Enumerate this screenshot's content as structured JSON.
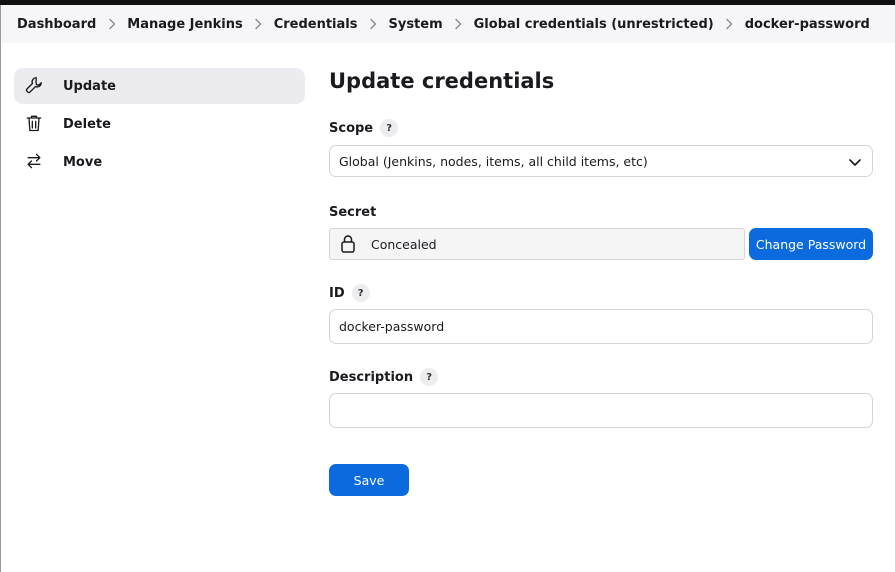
{
  "breadcrumb": [
    "Dashboard",
    "Manage Jenkins",
    "Credentials",
    "System",
    "Global credentials (unrestricted)",
    "docker-password"
  ],
  "sidebar": {
    "items": [
      {
        "label": "Update",
        "icon": "wrench-icon",
        "active": true
      },
      {
        "label": "Delete",
        "icon": "trash-icon",
        "active": false
      },
      {
        "label": "Move",
        "icon": "arrows-swap-icon",
        "active": false
      }
    ]
  },
  "main": {
    "title": "Update credentials",
    "scope": {
      "label": "Scope",
      "help": "?",
      "value": "Global (Jenkins, nodes, items, all child items, etc)"
    },
    "secret": {
      "label": "Secret",
      "value": "Concealed",
      "button": "Change Password"
    },
    "id": {
      "label": "ID",
      "help": "?",
      "value": "docker-password"
    },
    "description": {
      "label": "Description",
      "help": "?",
      "value": ""
    },
    "save": "Save"
  },
  "colors": {
    "accent": "#0b6bde",
    "breadcrumb_bg": "#f6f6f8",
    "sidebar_active": "#ececf0"
  }
}
